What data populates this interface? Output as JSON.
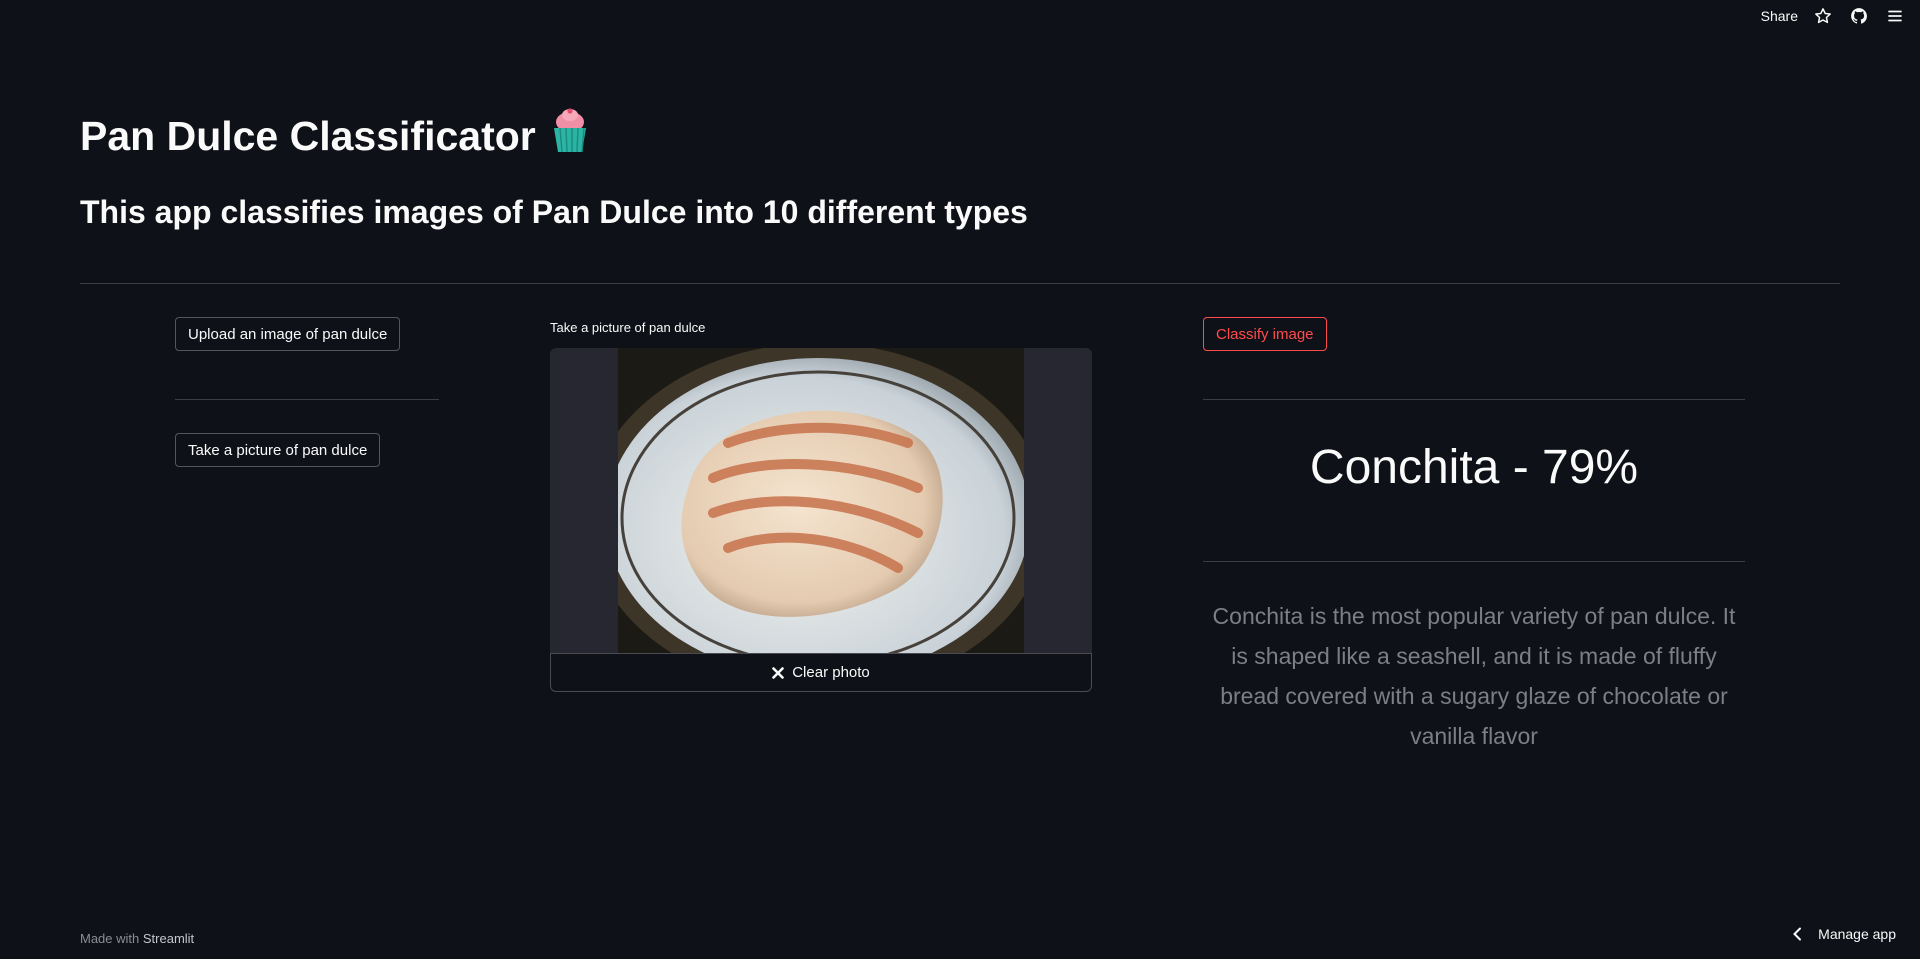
{
  "toolbar": {
    "share_label": "Share",
    "icons": [
      "star-icon",
      "github-icon",
      "hamburger-menu-icon"
    ]
  },
  "header": {
    "title": "Pan Dulce Classificator",
    "title_emoji": "cupcake-emoji-icon",
    "subtitle": "This app classifies images of Pan Dulce into 10 different types"
  },
  "left_column": {
    "upload_button": "Upload an image of pan dulce",
    "camera_button": "Take a picture of pan dulce"
  },
  "camera": {
    "label": "Take a picture of pan dulce",
    "clear_button": "Clear photo"
  },
  "right_column": {
    "classify_button": "Classify image",
    "result": "Conchita - 79%",
    "description": "Conchita is the most popular variety of pan dulce. It is shaped like a seashell, and it is made of fluffy bread covered with a sugary glaze of chocolate or vanilla flavor"
  },
  "footer": {
    "made_with": "Made with",
    "brand": "Streamlit",
    "manage_app": "Manage app"
  },
  "colors": {
    "background": "#0e1117",
    "accent_red": "#ff4b4b",
    "muted_text": "#7d7f87",
    "divider": "#3a3d48"
  }
}
